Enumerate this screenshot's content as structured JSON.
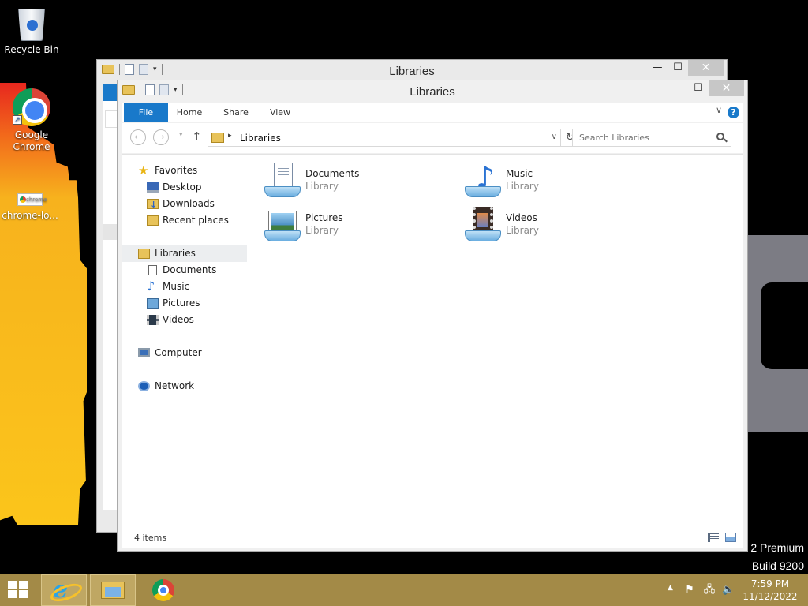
{
  "desktop": {
    "icons": [
      {
        "label": "Recycle Bin",
        "icon": "recycle-bin-icon"
      },
      {
        "label": "Google Chrome",
        "icon": "chrome-icon"
      },
      {
        "label": "chrome-lo...",
        "icon": "chrome-log-file-icon",
        "thumb_text": "chrome"
      }
    ],
    "watermark": {
      "line1": "2 Premium",
      "line2": "Build 9200"
    }
  },
  "back_window": {
    "title": "Libraries",
    "controls": {
      "minimize": "—",
      "maximize": "☐",
      "close": "✕"
    }
  },
  "window": {
    "title": "Libraries",
    "controls": {
      "minimize": "—",
      "maximize": "☐",
      "close": "✕"
    },
    "ribbon": {
      "tabs": [
        "File",
        "Home",
        "Share",
        "View"
      ],
      "expand": "∨",
      "help": "?"
    },
    "navbar": {
      "back": "←",
      "forward": "→",
      "recent": "▾",
      "up": "↑",
      "breadcrumb": [
        "Libraries"
      ],
      "crumb_separator": "▸",
      "address_dropdown": "∨",
      "refresh": "↻",
      "search_placeholder": "Search Libraries"
    },
    "nav_pane": {
      "favorites": {
        "label": "Favorites",
        "icon": "star-icon",
        "items": [
          {
            "label": "Desktop",
            "icon": "desktop-icon"
          },
          {
            "label": "Downloads",
            "icon": "downloads-folder-icon"
          },
          {
            "label": "Recent places",
            "icon": "recent-places-icon"
          }
        ]
      },
      "libraries": {
        "label": "Libraries",
        "icon": "libraries-icon",
        "selected": true,
        "items": [
          {
            "label": "Documents",
            "icon": "document-icon"
          },
          {
            "label": "Music",
            "icon": "music-note-icon"
          },
          {
            "label": "Pictures",
            "icon": "pictures-icon"
          },
          {
            "label": "Videos",
            "icon": "videos-icon"
          }
        ]
      },
      "computer": {
        "label": "Computer",
        "icon": "computer-icon"
      },
      "network": {
        "label": "Network",
        "icon": "network-icon"
      }
    },
    "libraries": [
      {
        "name": "Documents",
        "type": "Library",
        "icon": "documents-library-icon"
      },
      {
        "name": "Music",
        "type": "Library",
        "icon": "music-library-icon"
      },
      {
        "name": "Pictures",
        "type": "Library",
        "icon": "pictures-library-icon"
      },
      {
        "name": "Videos",
        "type": "Library",
        "icon": "videos-library-icon"
      }
    ],
    "status": {
      "item_count": "4 items"
    }
  },
  "taskbar": {
    "pinned": [
      {
        "name": "Internet Explorer",
        "icon": "internet-explorer-icon",
        "glyph": "e"
      },
      {
        "name": "File Explorer",
        "icon": "file-explorer-icon",
        "active": true
      },
      {
        "name": "Google Chrome",
        "icon": "chrome-icon"
      }
    ],
    "tray": {
      "show_hidden": "▲",
      "flag": "⚑",
      "network": "🖧",
      "volume": "🔈"
    },
    "clock": {
      "time": "7:59 PM",
      "date": "11/12/2022"
    }
  },
  "colors": {
    "accent": "#1979ca",
    "taskbar": "#a38a47",
    "desktop": "#000000"
  }
}
